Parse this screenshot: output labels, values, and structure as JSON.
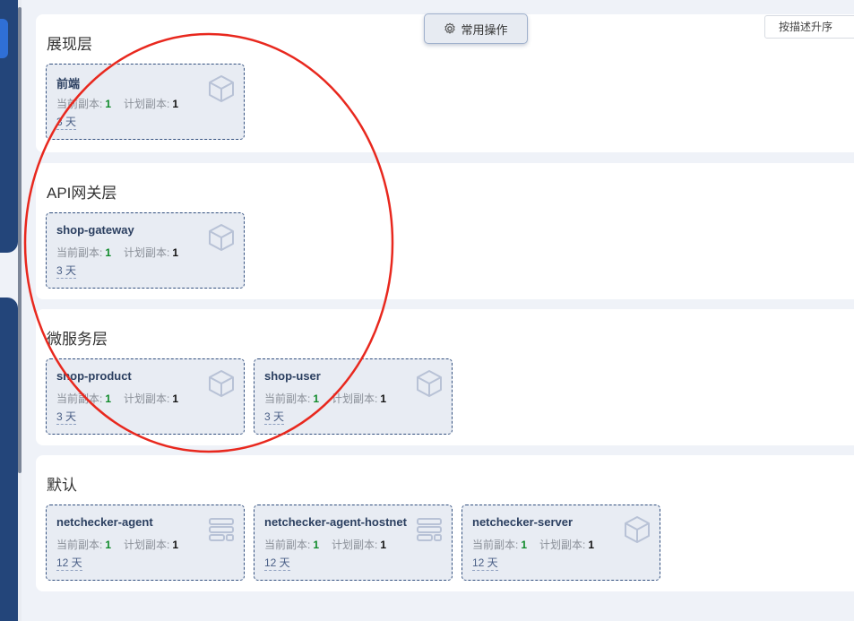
{
  "toolbar": {
    "ops_label": "常用操作",
    "sort_label": "按描述升序"
  },
  "labels": {
    "current_replicas": "当前副本:",
    "planned_replicas": "计划副本:"
  },
  "groups": [
    {
      "title": "展现层",
      "cards": [
        {
          "name": "前端",
          "current": "1",
          "planned": "1",
          "age": "3 天",
          "icon": "cube-icon"
        }
      ]
    },
    {
      "title": "API网关层",
      "cards": [
        {
          "name": "shop-gateway",
          "current": "1",
          "planned": "1",
          "age": "3 天",
          "icon": "cube-icon"
        }
      ]
    },
    {
      "title": "微服务层",
      "cards": [
        {
          "name": "shop-product",
          "current": "1",
          "planned": "1",
          "age": "3 天",
          "icon": "cube-icon"
        },
        {
          "name": "shop-user",
          "current": "1",
          "planned": "1",
          "age": "3 天",
          "icon": "cube-icon"
        }
      ]
    },
    {
      "title": "默认",
      "cards": [
        {
          "name": "netchecker-agent",
          "current": "1",
          "planned": "1",
          "age": "12 天",
          "icon": "daemonset-icon"
        },
        {
          "name": "netchecker-agent-hostnet",
          "current": "1",
          "planned": "1",
          "age": "12 天",
          "icon": "daemonset-icon"
        },
        {
          "name": "netchecker-server",
          "current": "1",
          "planned": "1",
          "age": "12 天",
          "icon": "cube-icon"
        }
      ]
    }
  ],
  "colors": {
    "sidebar": "#23457a",
    "card_border": "#33507f",
    "current_count": "#0f8a2a",
    "annotation": "#e8281e"
  }
}
